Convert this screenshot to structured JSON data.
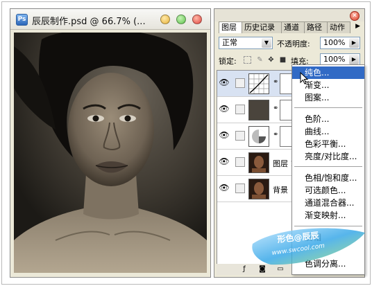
{
  "document": {
    "app_icon_text": "Ps",
    "title": "辰辰制作.psd @ 66.7% (..."
  },
  "panel": {
    "tabs": [
      {
        "label": "图层",
        "active": true
      },
      {
        "label": "历史记录",
        "active": false
      },
      {
        "label": "通道",
        "active": false
      },
      {
        "label": "路径",
        "active": false
      },
      {
        "label": "动作",
        "active": false
      }
    ],
    "blend_mode": "正常",
    "opacity_label": "不透明度:",
    "opacity_value": "100%",
    "lock_label": "锁定:",
    "fill_label": "填充:",
    "fill_value": "100%",
    "layers": [
      {
        "type": "curves-adjustment",
        "name": "",
        "visible": true,
        "selected": true
      },
      {
        "type": "solid-color-fill",
        "name": "",
        "visible": true,
        "selected": false
      },
      {
        "type": "hue-saturation-adjustment",
        "name": "",
        "visible": true,
        "selected": false
      },
      {
        "type": "photo",
        "name": "图层 1",
        "visible": true,
        "selected": false
      },
      {
        "type": "photo",
        "name": "背景",
        "visible": true,
        "selected": false
      }
    ]
  },
  "menu": {
    "groups": [
      [
        "纯色...",
        "渐变...",
        "图案..."
      ],
      [
        "色阶...",
        "曲线...",
        "色彩平衡...",
        "亮度/对比度..."
      ],
      [
        "色相/饱和度...",
        "可选颜色...",
        "通道混合器...",
        "渐变映射..."
      ],
      [
        "反相",
        "色调分离..."
      ]
    ],
    "highlighted": "纯色..."
  },
  "watermark": {
    "line1": "形色@辰辰",
    "line2": "www.swcool.com"
  },
  "colors": {
    "menu_highlight": "#316ac5",
    "mac_close": "#e0443e",
    "mac_min": "#e6b23a",
    "mac_max": "#5cc24a"
  }
}
